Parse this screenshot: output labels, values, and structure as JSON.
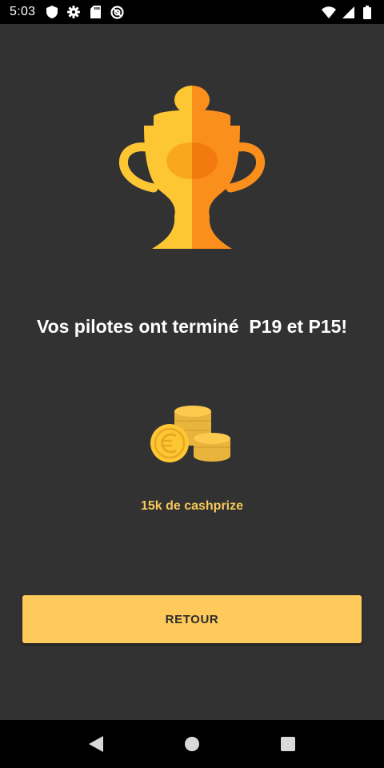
{
  "status_bar": {
    "time": "5:03",
    "left_icons": [
      "shield-icon",
      "gear-icon",
      "sd-card-icon",
      "no-disturb-icon"
    ],
    "right_icons": [
      "wifi-icon",
      "signal-icon",
      "battery-icon"
    ]
  },
  "screen": {
    "trophy_icon": "trophy-icon",
    "message": "Vos pilotes ont terminé  P19 et P15!",
    "coins_icon": "euro-coins-icon",
    "prize_text": "15k de cashprize",
    "button_label": "RETOUR"
  },
  "nav_bar": {
    "buttons": [
      "back-icon",
      "home-icon",
      "recents-icon"
    ]
  },
  "colors": {
    "background": "#323232",
    "accent": "#fdca5b",
    "prize_text": "#f7c85a",
    "trophy_light": "#fdc733",
    "trophy_dark": "#fb8f1b"
  }
}
